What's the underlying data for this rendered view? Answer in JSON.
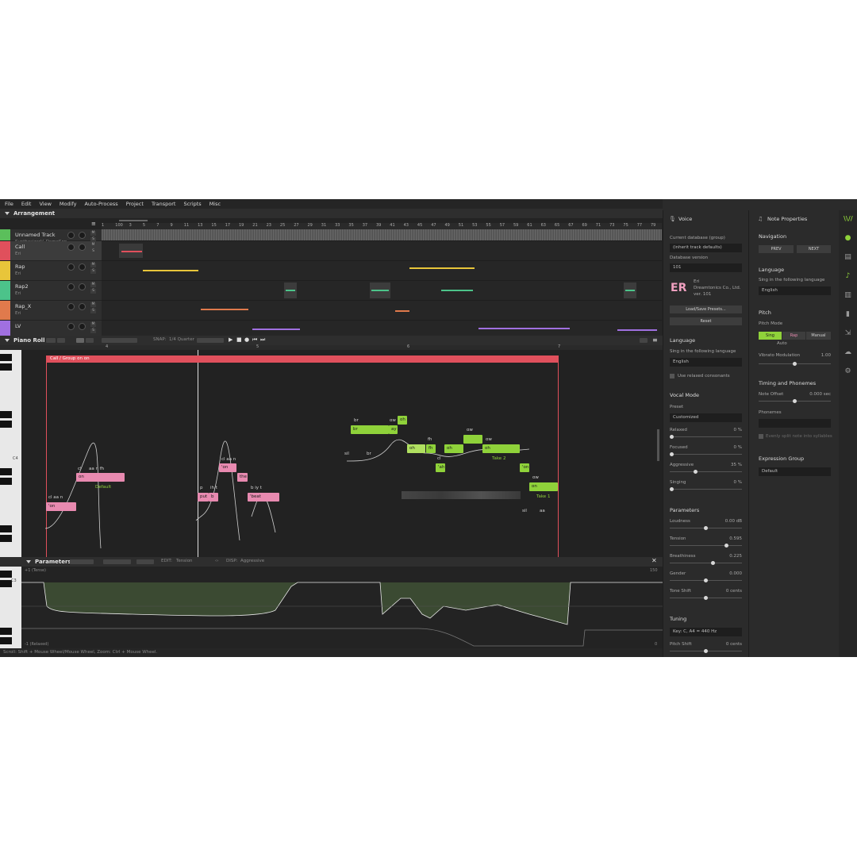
{
  "menu": [
    "File",
    "Edit",
    "View",
    "Modify",
    "Auto-Process",
    "Project",
    "Transport",
    "Scripts",
    "Misc"
  ],
  "arrangement": {
    "title": "Arrangement",
    "ruler": [
      "1",
      "100",
      "3",
      "5",
      "7",
      "9",
      "11",
      "13",
      "15",
      "17",
      "19",
      "21",
      "23",
      "25",
      "27",
      "29",
      "31",
      "33",
      "35",
      "37",
      "39",
      "41",
      "43",
      "45",
      "47",
      "49",
      "51",
      "53",
      "55",
      "57",
      "59",
      "61",
      "63",
      "65",
      "67",
      "69",
      "71",
      "73",
      "75",
      "77",
      "79"
    ],
    "tracks": [
      {
        "name": "Unnamed Track",
        "sub": "SynthesizerV_DemoSon...",
        "color": "#5bbf5b"
      },
      {
        "name": "Call",
        "sub": "Eri",
        "color": "#e0505c"
      },
      {
        "name": "Rap",
        "sub": "Eri",
        "color": "#e8c53a"
      },
      {
        "name": "Rap2",
        "sub": "Eri",
        "color": "#4cc38a"
      },
      {
        "name": "Rap_X",
        "sub": "Eri",
        "color": "#e07a4c"
      },
      {
        "name": "LV",
        "sub": "",
        "color": "#a070e0"
      }
    ],
    "ms": [
      "M",
      "S"
    ]
  },
  "pianoroll": {
    "title": "Piano Roll",
    "snap_label": "SNAP:",
    "snap_value": "1/4 Quarter",
    "bars": [
      "4",
      "5",
      "6",
      "7"
    ],
    "group": "Call / Group on on",
    "c4": "C4",
    "notes": [
      {
        "text": "'on",
        "color": "pink"
      },
      {
        "text": "on",
        "color": "pink"
      },
      {
        "text": "'on",
        "color": "pink"
      },
      {
        "text": "the",
        "color": "pink"
      },
      {
        "text": "put",
        "color": "pink"
      },
      {
        "text": "b",
        "color": "pink"
      },
      {
        "text": "'beat",
        "color": "pink"
      },
      {
        "text": "br",
        "color": "green"
      },
      {
        "text": "ay",
        "color": "green"
      },
      {
        "text": "oh",
        "color": "green"
      },
      {
        "text": "oh",
        "color": "green"
      },
      {
        "text": "fh",
        "color": "green"
      },
      {
        "text": "oh",
        "color": "green"
      },
      {
        "text": "'ah",
        "color": "green"
      },
      {
        "text": "oh",
        "color": "green"
      },
      {
        "text": "'on",
        "color": "green"
      },
      {
        "text": "on",
        "color": "green"
      }
    ],
    "phonemes": [
      "cl aa n",
      "cl",
      "aa n fh",
      "Default",
      "cl aa n",
      "ih t",
      "b iy t",
      "br",
      "ow",
      "ow",
      "fh",
      "ow",
      "ow",
      "sil",
      "br",
      "cl",
      "Take 1",
      "Take 2",
      "sil",
      "aa",
      "p"
    ]
  },
  "parameters": {
    "title": "Parameters",
    "edit_label": "EDIT:",
    "edit_value": "Tension",
    "disp_label": "DISP:",
    "disp_value": "Aggressive",
    "top_label": "+1 (Tense)",
    "bottom_label": "-1 (Relaxed)",
    "max": "150",
    "min": "0",
    "c3": "C3"
  },
  "status": "Scroll: Shift + Mouse Wheel/Mouse Wheel, Zoom: Ctrl + Mouse Wheel.",
  "voice": {
    "title": "Voice",
    "db_group_label": "Current database (group)",
    "db_group_value": "(inherit track defaults)",
    "db_version_label": "Database version",
    "db_version_value": "101",
    "voice_name": "Eri",
    "voice_company": "Dreamtonics Co., Ltd.",
    "voice_ver": "ver. 101",
    "avatar_text": "ER",
    "load_presets": "Load/Save Presets...",
    "reset": "Reset",
    "language_title": "Language",
    "language_label": "Sing in the following language",
    "language_value": "English",
    "relaxed_consonants": "Use relaxed consonants",
    "vocal_mode_title": "Vocal Mode",
    "preset_label": "Preset",
    "preset_value": "Customized",
    "modes": [
      {
        "label": "Relaxed",
        "value": "0 %",
        "level": 0
      },
      {
        "label": "Focused",
        "value": "0 %",
        "level": 0
      },
      {
        "label": "Aggressive",
        "value": "35 %",
        "level": 0.35
      },
      {
        "label": "Singing",
        "value": "0 %",
        "level": 0
      }
    ],
    "parameters_title": "Parameters",
    "params": [
      {
        "label": "Loudness",
        "value": "0.00 dB",
        "level": 0.5
      },
      {
        "label": "Tension",
        "value": "0.595",
        "level": 0.8
      },
      {
        "label": "Breathiness",
        "value": "0.225",
        "level": 0.61
      },
      {
        "label": "Gender",
        "value": "0.000",
        "level": 0.5
      },
      {
        "label": "Tone Shift",
        "value": "0 cents",
        "level": 0.5
      }
    ],
    "tuning_title": "Tuning",
    "key_value": "Key: C, A4 = 440 Hz",
    "pitch_shift_label": "Pitch Shift",
    "pitch_shift_value": "0 cents"
  },
  "note_props": {
    "title": "Note Properties",
    "navigation_title": "Navigation",
    "prev": "PREV",
    "next": "NEXT",
    "language_title": "Language",
    "language_label": "Sing in the following language",
    "language_value": "English",
    "pitch_title": "Pitch",
    "pitch_mode_label": "Pitch Mode",
    "pitch_modes": [
      "Sing",
      "Rap",
      "Manual"
    ],
    "auto_label": "Auto",
    "vibrato_label": "Vibrato Modulation",
    "vibrato_value": "1.00",
    "timing_title": "Timing and Phonemes",
    "note_offset_label": "Note Offset",
    "note_offset_value": "0.000 sec",
    "phonemes_label": "Phonemes",
    "split_label": "Evenly split note into syllables",
    "expression_title": "Expression Group",
    "expression_value": "Default"
  }
}
